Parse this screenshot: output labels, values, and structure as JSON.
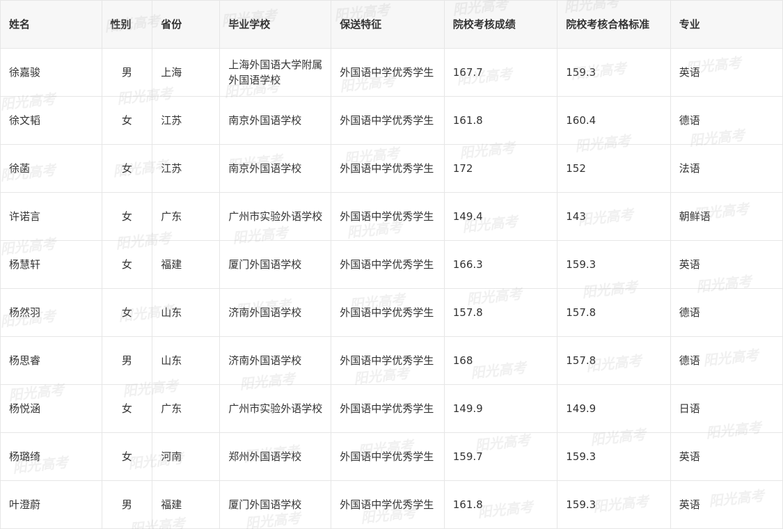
{
  "table": {
    "headers": [
      "姓名",
      "性别",
      "省份",
      "毕业学校",
      "保送特征",
      "院校考核成绩",
      "院校考核合格标准",
      "专业"
    ],
    "rows": [
      [
        "徐嘉骏",
        "男",
        "上海",
        "上海外国语大学附属外国语学校",
        "外国语中学优秀学生",
        "167.7",
        "159.3",
        "英语"
      ],
      [
        "徐文韬",
        "女",
        "江苏",
        "南京外国语学校",
        "外国语中学优秀学生",
        "161.8",
        "160.4",
        "德语"
      ],
      [
        "徐菡",
        "女",
        "江苏",
        "南京外国语学校",
        "外国语中学优秀学生",
        "172",
        "152",
        "法语"
      ],
      [
        "许诺言",
        "女",
        "广东",
        "广州市实验外语学校",
        "外国语中学优秀学生",
        "149.4",
        "143",
        "朝鲜语"
      ],
      [
        "杨慧轩",
        "女",
        "福建",
        "厦门外国语学校",
        "外国语中学优秀学生",
        "166.3",
        "159.3",
        "英语"
      ],
      [
        "杨然羽",
        "女",
        "山东",
        "济南外国语学校",
        "外国语中学优秀学生",
        "157.8",
        "157.8",
        "德语"
      ],
      [
        "杨思睿",
        "男",
        "山东",
        "济南外国语学校",
        "外国语中学优秀学生",
        "168",
        "157.8",
        "德语"
      ],
      [
        "杨悦涵",
        "女",
        "广东",
        "广州市实验外语学校",
        "外国语中学优秀学生",
        "149.9",
        "149.9",
        "日语"
      ],
      [
        "杨璐绮",
        "女",
        "河南",
        "郑州外国语学校",
        "外国语中学优秀学生",
        "159.7",
        "159.3",
        "英语"
      ],
      [
        "叶澄蔚",
        "男",
        "福建",
        "厦门外国语学校",
        "外国语中学优秀学生",
        "161.8",
        "159.3",
        "英语"
      ]
    ]
  },
  "watermark": {
    "text": "阳光高考"
  }
}
